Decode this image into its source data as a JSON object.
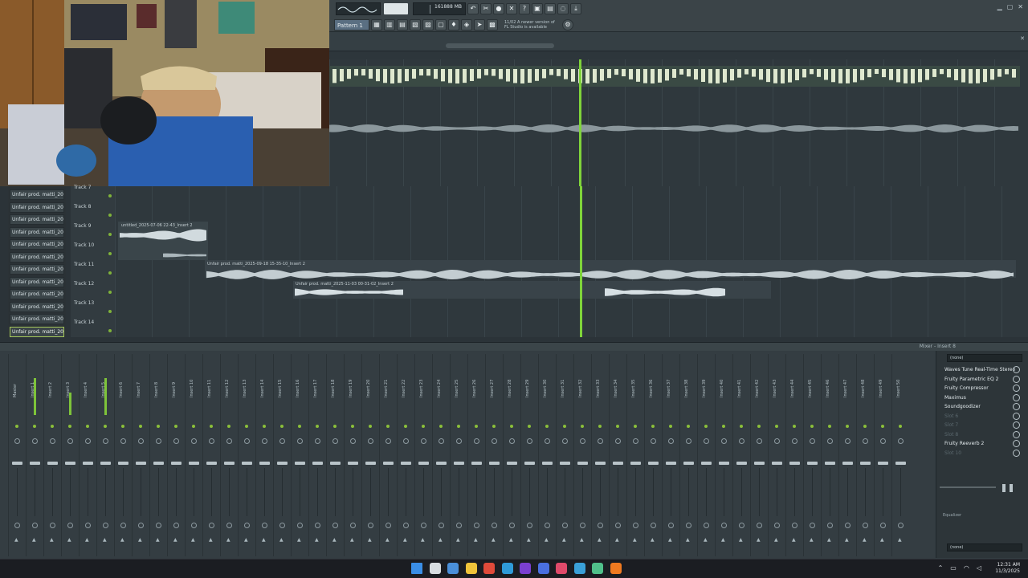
{
  "toolbar": {
    "cpu_value": "16",
    "memory": "1888 MB",
    "voice_count": "3",
    "pattern_label": "Pattern 1",
    "notice_text": "11/02  A newer version of FL Studio is available",
    "buttons": [
      "undo-icon",
      "redo-icon",
      "mic-icon",
      "cut-icon",
      "help-icon",
      "save-icon",
      "chat-icon",
      "download-icon"
    ]
  },
  "channel_rack": {
    "items": [
      "Unfair prod. matti_2025",
      "Unfair prod. matti_2025",
      "Unfair prod. matti_2025",
      "Unfair prod. matti_2025",
      "Unfair prod. matti_2025",
      "Unfair prod. matti_2025",
      "Unfair prod. matti_2025",
      "Unfair prod. matti_2025",
      "Unfair prod. matti_2025",
      "Unfair prod. matti_2025",
      "Unfair prod. matti_2025",
      "Unfair prod. matti_2025"
    ]
  },
  "playlist": {
    "tracks": [
      "Track 7",
      "Track 8",
      "Track 9",
      "Track 10",
      "Track 11",
      "Track 12",
      "Track 13",
      "Track 14"
    ],
    "clips": [
      "untitled_2025-07-06 22-43_Insert 2",
      "Unfair prod. matti_2025-09-18 15-35-10_Insert 2",
      "Unfair prod. matti_2025-11-03 00-31-02_Insert 2"
    ]
  },
  "mixer": {
    "title": "Mixer - Insert 8",
    "strips": [
      "Master",
      "Insert 1",
      "Insert 2",
      "Insert 3",
      "Insert 4",
      "Insert 5",
      "Insert 6",
      "Insert 7",
      "Insert 8",
      "Insert 9",
      "Insert 10",
      "Insert 11",
      "Insert 12",
      "Insert 13",
      "Insert 14",
      "Insert 15",
      "Insert 16",
      "Insert 17",
      "Insert 18",
      "Insert 19",
      "Insert 20",
      "Insert 21",
      "Insert 22",
      "Insert 23",
      "Insert 24",
      "Insert 25",
      "Insert 26",
      "Insert 27",
      "Insert 28",
      "Insert 29",
      "Insert 30",
      "Insert 31",
      "Insert 32",
      "Insert 33",
      "Insert 34",
      "Insert 35",
      "Insert 36",
      "Insert 37",
      "Insert 38",
      "Insert 39",
      "Insert 40",
      "Insert 41",
      "Insert 42",
      "Insert 43",
      "Insert 44",
      "Insert 45",
      "Insert 46",
      "Insert 47",
      "Insert 48",
      "Insert 49",
      "Insert 50"
    ],
    "panel": {
      "input": "(none)",
      "output": "(none)",
      "equalizer_label": "Equalizer",
      "slots": [
        {
          "label": "Waves Tune Real-Time Stereo",
          "active": true
        },
        {
          "label": "Fruity Parametric EQ 2",
          "active": true
        },
        {
          "label": "Fruity Compressor",
          "active": true
        },
        {
          "label": "Maximus",
          "active": true
        },
        {
          "label": "Soundgoodizer",
          "active": true
        },
        {
          "label": "Slot 6",
          "active": false
        },
        {
          "label": "Slot 7",
          "active": false
        },
        {
          "label": "Slot 8",
          "active": false
        },
        {
          "label": "Fruity Reeverb 2",
          "active": true
        },
        {
          "label": "Slot 10",
          "active": false
        }
      ]
    }
  },
  "taskbar": {
    "time": "12:31 AM",
    "date": "11/3/2025",
    "apps": [
      "windows-start-icon",
      "search-icon",
      "file-explorer-icon",
      "folder-icon",
      "chrome-icon",
      "edge-icon",
      "app-icon",
      "messenger-icon",
      "music-icon",
      "app-icon",
      "app-icon",
      "fl-studio-icon"
    ]
  },
  "colors": {
    "accent_green": "#8bbf3a",
    "playhead": "#7fd43a",
    "waveform": "#d6dfe3",
    "panel_bg": "#2f383d"
  }
}
